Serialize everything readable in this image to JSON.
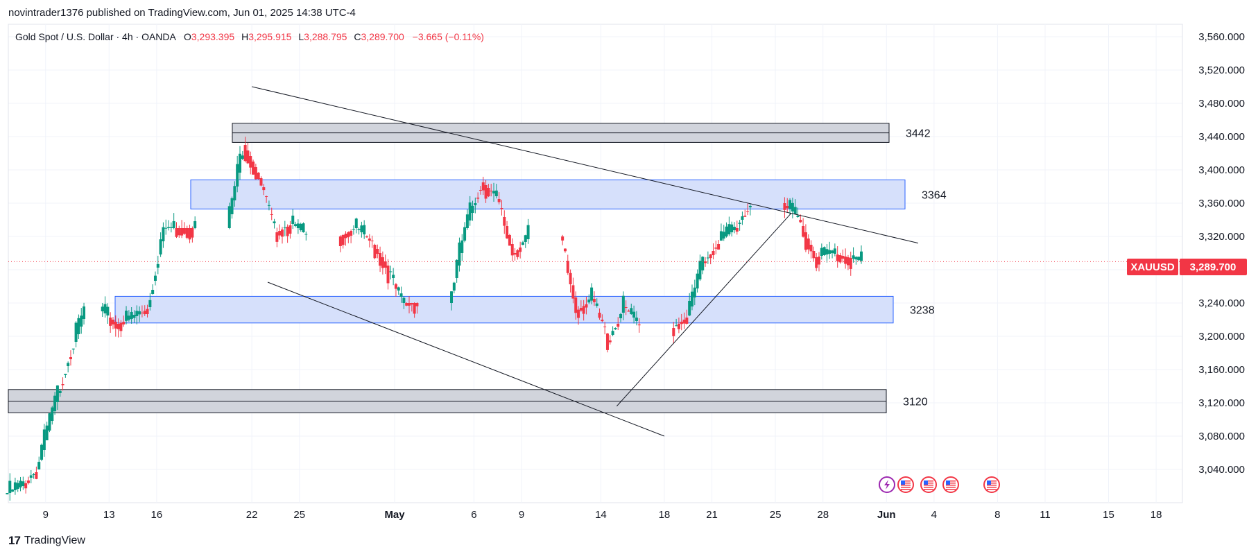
{
  "header": {
    "published": "novintrader1376 published on TradingView.com, Jun 01, 2025 14:38 UTC-4"
  },
  "footer": {
    "brand": "TradingView",
    "brand_mark": "17"
  },
  "legend": {
    "symbol": "Gold Spot / U.S. Dollar · 4h · OANDA",
    "open_label": "O",
    "open": "3,293.395",
    "high_label": "H",
    "high": "3,295.915",
    "low_label": "L",
    "low": "3,288.795",
    "close_label": "C",
    "close": "3,289.700",
    "change": "−3.665 (−0.11%)"
  },
  "price_tag": {
    "symbol": "XAUUSD",
    "price": "3,289.700"
  },
  "events": {
    "icons": [
      "lightning-icon",
      "us-flag-icon",
      "us-flag-icon",
      "us-flag-icon",
      "us-flag-icon"
    ]
  },
  "colors": {
    "up": "#089981",
    "down": "#f23645",
    "grid": "#f0f3fa",
    "blue_zone": "#d6e0fb",
    "blue_border": "#2962ff",
    "gray_zone": "#d1d4dc",
    "trendline": "#131722",
    "price_tag": "#f23645"
  },
  "chart_data": {
    "type": "candlestick",
    "title": "Gold Spot / U.S. Dollar · 4h · OANDA",
    "ylim": [
      3000,
      3575
    ],
    "y_ticks": [
      "3,560.000",
      "3,520.000",
      "3,480.000",
      "3,440.000",
      "3,400.000",
      "3,360.000",
      "3,320.000",
      "3,280.000",
      "3,240.000",
      "3,200.000",
      "3,160.000",
      "3,120.000",
      "3,080.000",
      "3,040.000"
    ],
    "x_ticks": [
      "9",
      "13",
      "16",
      "22",
      "25",
      "May",
      "6",
      "9",
      "14",
      "18",
      "21",
      "25",
      "28",
      "Jun",
      "4",
      "8",
      "11",
      "15",
      "18"
    ],
    "last_price": 3289.7,
    "zones": [
      {
        "label": "3442",
        "type": "resistance",
        "from": 3433,
        "to": 3456
      },
      {
        "label": "3364",
        "type": "resistance",
        "from": 3353,
        "to": 3388
      },
      {
        "label": "3238",
        "type": "support",
        "from": 3216,
        "to": 3248
      },
      {
        "label": "3120",
        "type": "support",
        "from": 3108,
        "to": 3136
      }
    ],
    "trendlines": [
      {
        "name": "upper-falling",
        "from": [
          "Apr 22",
          3500
        ],
        "to": [
          "Jun 3",
          3312
        ]
      },
      {
        "name": "lower-falling",
        "from": [
          "Apr 23",
          3265
        ],
        "to": [
          "May 18",
          3080
        ]
      },
      {
        "name": "rising-support",
        "from": [
          "May 15",
          3116
        ],
        "to": [
          "May 26",
          3348
        ]
      }
    ],
    "series": [
      {
        "name": "close",
        "x": [
          "Apr 7",
          "Apr 8",
          "Apr 9",
          "Apr 10",
          "Apr 11",
          "Apr 13",
          "Apr 14",
          "Apr 15",
          "Apr 16",
          "Apr 17",
          "Apr 18",
          "Apr 21",
          "Apr 22",
          "Apr 23",
          "Apr 24",
          "Apr 25",
          "Apr 28",
          "Apr 29",
          "Apr 30",
          "May 1",
          "May 2",
          "May 5",
          "May 6",
          "May 7",
          "May 8",
          "May 9",
          "May 12",
          "May 13",
          "May 14",
          "May 15",
          "May 16",
          "May 19",
          "May 20",
          "May 21",
          "May 22",
          "May 23",
          "May 26",
          "May 27",
          "May 28",
          "May 29",
          "May 30"
        ],
        "values": [
          3020,
          3040,
          3110,
          3175,
          3230,
          3215,
          3222,
          3235,
          3330,
          3330,
          3330,
          3430,
          3390,
          3325,
          3335,
          3320,
          3330,
          3315,
          3285,
          3240,
          3240,
          3330,
          3385,
          3365,
          3300,
          3320,
          3232,
          3245,
          3195,
          3235,
          3210,
          3225,
          3290,
          3315,
          3330,
          3360,
          3340,
          3295,
          3300,
          3295,
          3289.7
        ]
      }
    ]
  }
}
